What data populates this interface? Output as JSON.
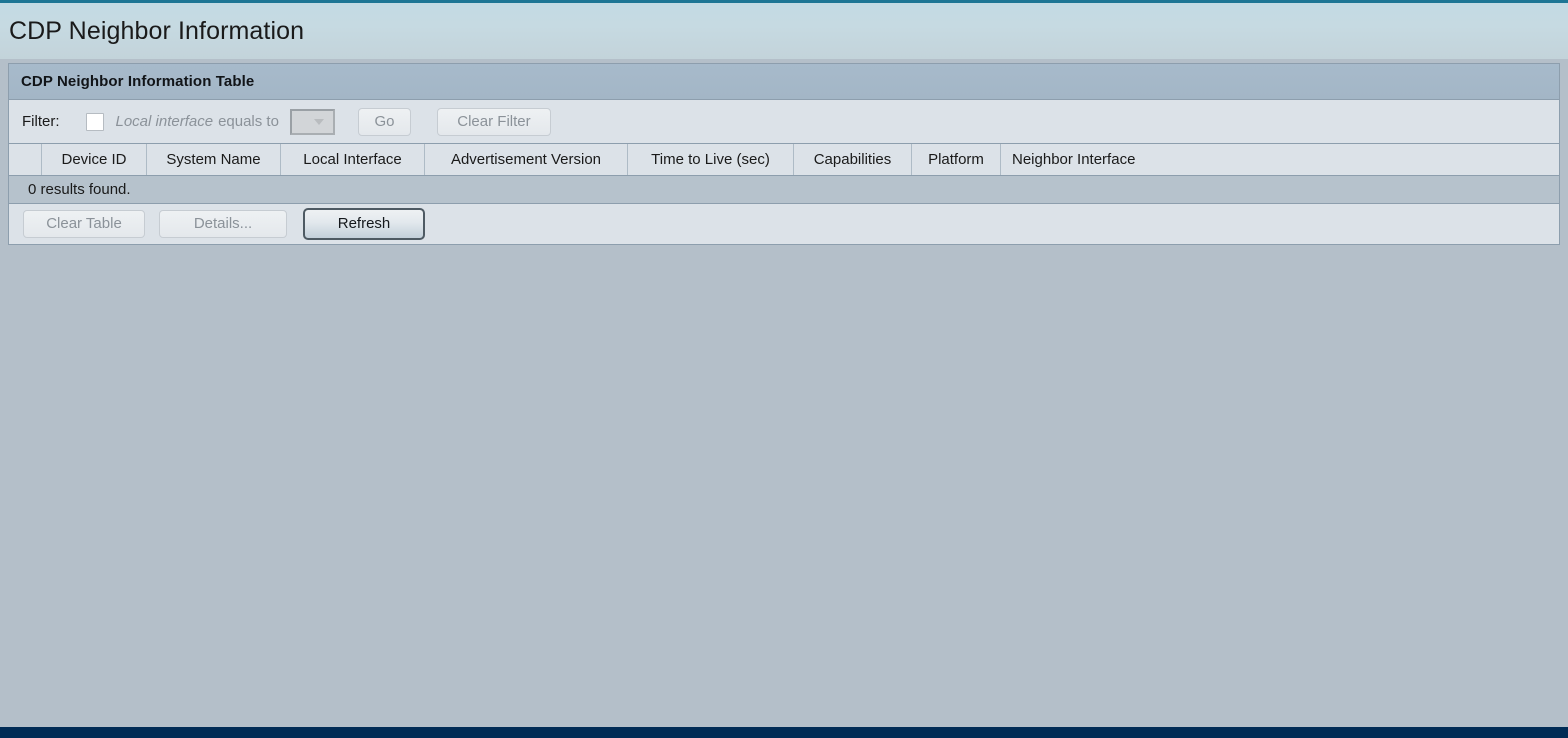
{
  "page": {
    "title": "CDP Neighbor Information"
  },
  "panel": {
    "title": "CDP Neighbor Information Table"
  },
  "filter": {
    "label": "Filter:",
    "checkbox_checked": false,
    "criteria_italic": "Local interface",
    "criteria_rest": "equals to",
    "select_value": "",
    "select_icon": "chevron-down-icon",
    "go_label": "Go",
    "clear_filter_label": "Clear Filter"
  },
  "table": {
    "columns": [
      "",
      "Device ID",
      "System Name",
      "Local Interface",
      "Advertisement Version",
      "Time to Live (sec)",
      "Capabilities",
      "Platform",
      "Neighbor Interface"
    ],
    "rows": [],
    "results_text": "0 results found."
  },
  "actions": {
    "clear_table_label": "Clear Table",
    "details_label": "Details...",
    "refresh_label": "Refresh"
  },
  "colors": {
    "accent_top": "#1d7595",
    "bottom_bar": "#002b55",
    "page_background": "#b4bfc9",
    "panel_titlebar": "#a5b8c8",
    "row_light": "#dce2e8",
    "row_results": "#b6c2cc",
    "focus_border": "#4e5a63"
  }
}
